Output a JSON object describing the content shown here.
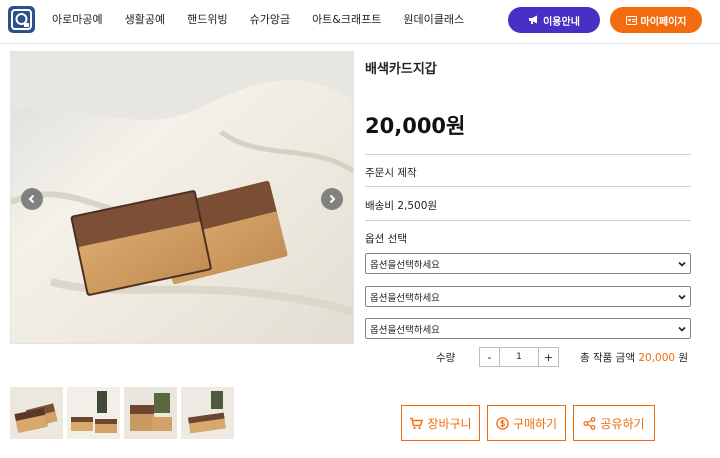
{
  "header": {
    "logo_icon": "logo-icon",
    "nav": [
      "아로마공예",
      "생활공예",
      "핸드위빙",
      "슈가앙금",
      "아트&크래프트",
      "원데이클래스"
    ],
    "guide_button": "이용안내",
    "mypage_button": "마이페이지",
    "colors": {
      "guide": "#4a2fc4",
      "mypage": "#f26b0f"
    }
  },
  "product": {
    "title": "배색카드지갑",
    "price": "20,000원",
    "made_to_order": "주문시 제작",
    "shipping": "배송비 2,500원",
    "option_heading": "옵션 선택",
    "option_selects": [
      "옵션을선택하세요",
      "옵션을선택하세요",
      "옵션을선택하세요"
    ],
    "quantity_label": "수량",
    "quantity": "1",
    "minus": "-",
    "plus": "+",
    "total_label": "총 작품 금액",
    "total_amount": "20,000",
    "total_unit": "원"
  },
  "gallery": {
    "prev_icon": "chevron-left-icon",
    "next_icon": "chevron-right-icon",
    "thumbnail_count": 4
  },
  "actions": {
    "cart": "장바구니",
    "buy": "구매하기",
    "share": "공유하기"
  },
  "accent_color": "#f26b0f"
}
